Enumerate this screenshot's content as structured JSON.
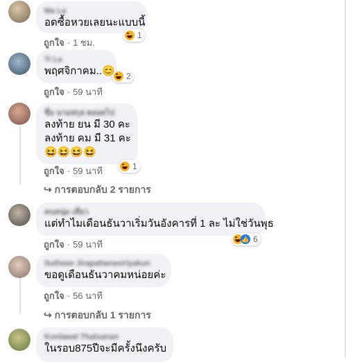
{
  "comments": [
    {
      "author": "Ma La",
      "lines": [
        "อดซื้อหวยเลยนะแบบนี้"
      ],
      "like": "ถูกใจ",
      "time": "1 ชม.",
      "reaction_count": "1",
      "reaction_icons": [
        "haha-icon"
      ]
    },
    {
      "author": "Ti La",
      "lines": [
        "พฤศจิกาคม..😊"
      ],
      "like": "ถูกใจ",
      "time": "59 นาที",
      "reaction_count": "2",
      "reaction_icons": [
        "haha-icon"
      ]
    },
    {
      "author": "ชื่อ นามสกุล ตลอดไป",
      "lines": [
        "ลงท้าย ยน มี 30 คะ",
        "ลงท้าย คม มี 31 คะ",
        "😆😆😆😆"
      ],
      "like": "ถูกใจ",
      "time": "59 นาที",
      "reaction_count": "1",
      "reaction_icons": [
        "haha-icon"
      ],
      "replies": "การตอบกลับ 2 รายการ"
    },
    {
      "author": "คนหนุ่ม เที่ยว",
      "lines": [
        "แต่ทำไมเดือนธันวาเริ่มวันอังคารที่ 1 ละ ไม่ใช่วันพุธ"
      ],
      "like": "ถูกใจ",
      "time": "59 นาที",
      "reaction_count": "6",
      "reaction_icons": [
        "haha-icon",
        "like-icon"
      ]
    },
    {
      "author": "Sutheee Jirapattanasiriyakun",
      "lines": [
        "ขอดูเดือนธันวาคมหน่อยค่ะ"
      ],
      "like": "ถูกใจ",
      "time": "56 นาที",
      "replies": "การตอบกลับ 1 รายการ"
    },
    {
      "author": "Konlawat Thatsanan",
      "lines": [
        "ในรอบ875ปีจะมีครั้งนึงครับ"
      ]
    }
  ],
  "separator": "·",
  "reply_arrow": "↪",
  "colors": {
    "bubble": "#f0f2f5",
    "meta": "#65676b",
    "haha": "#f7b125",
    "like": "#1877f2"
  }
}
